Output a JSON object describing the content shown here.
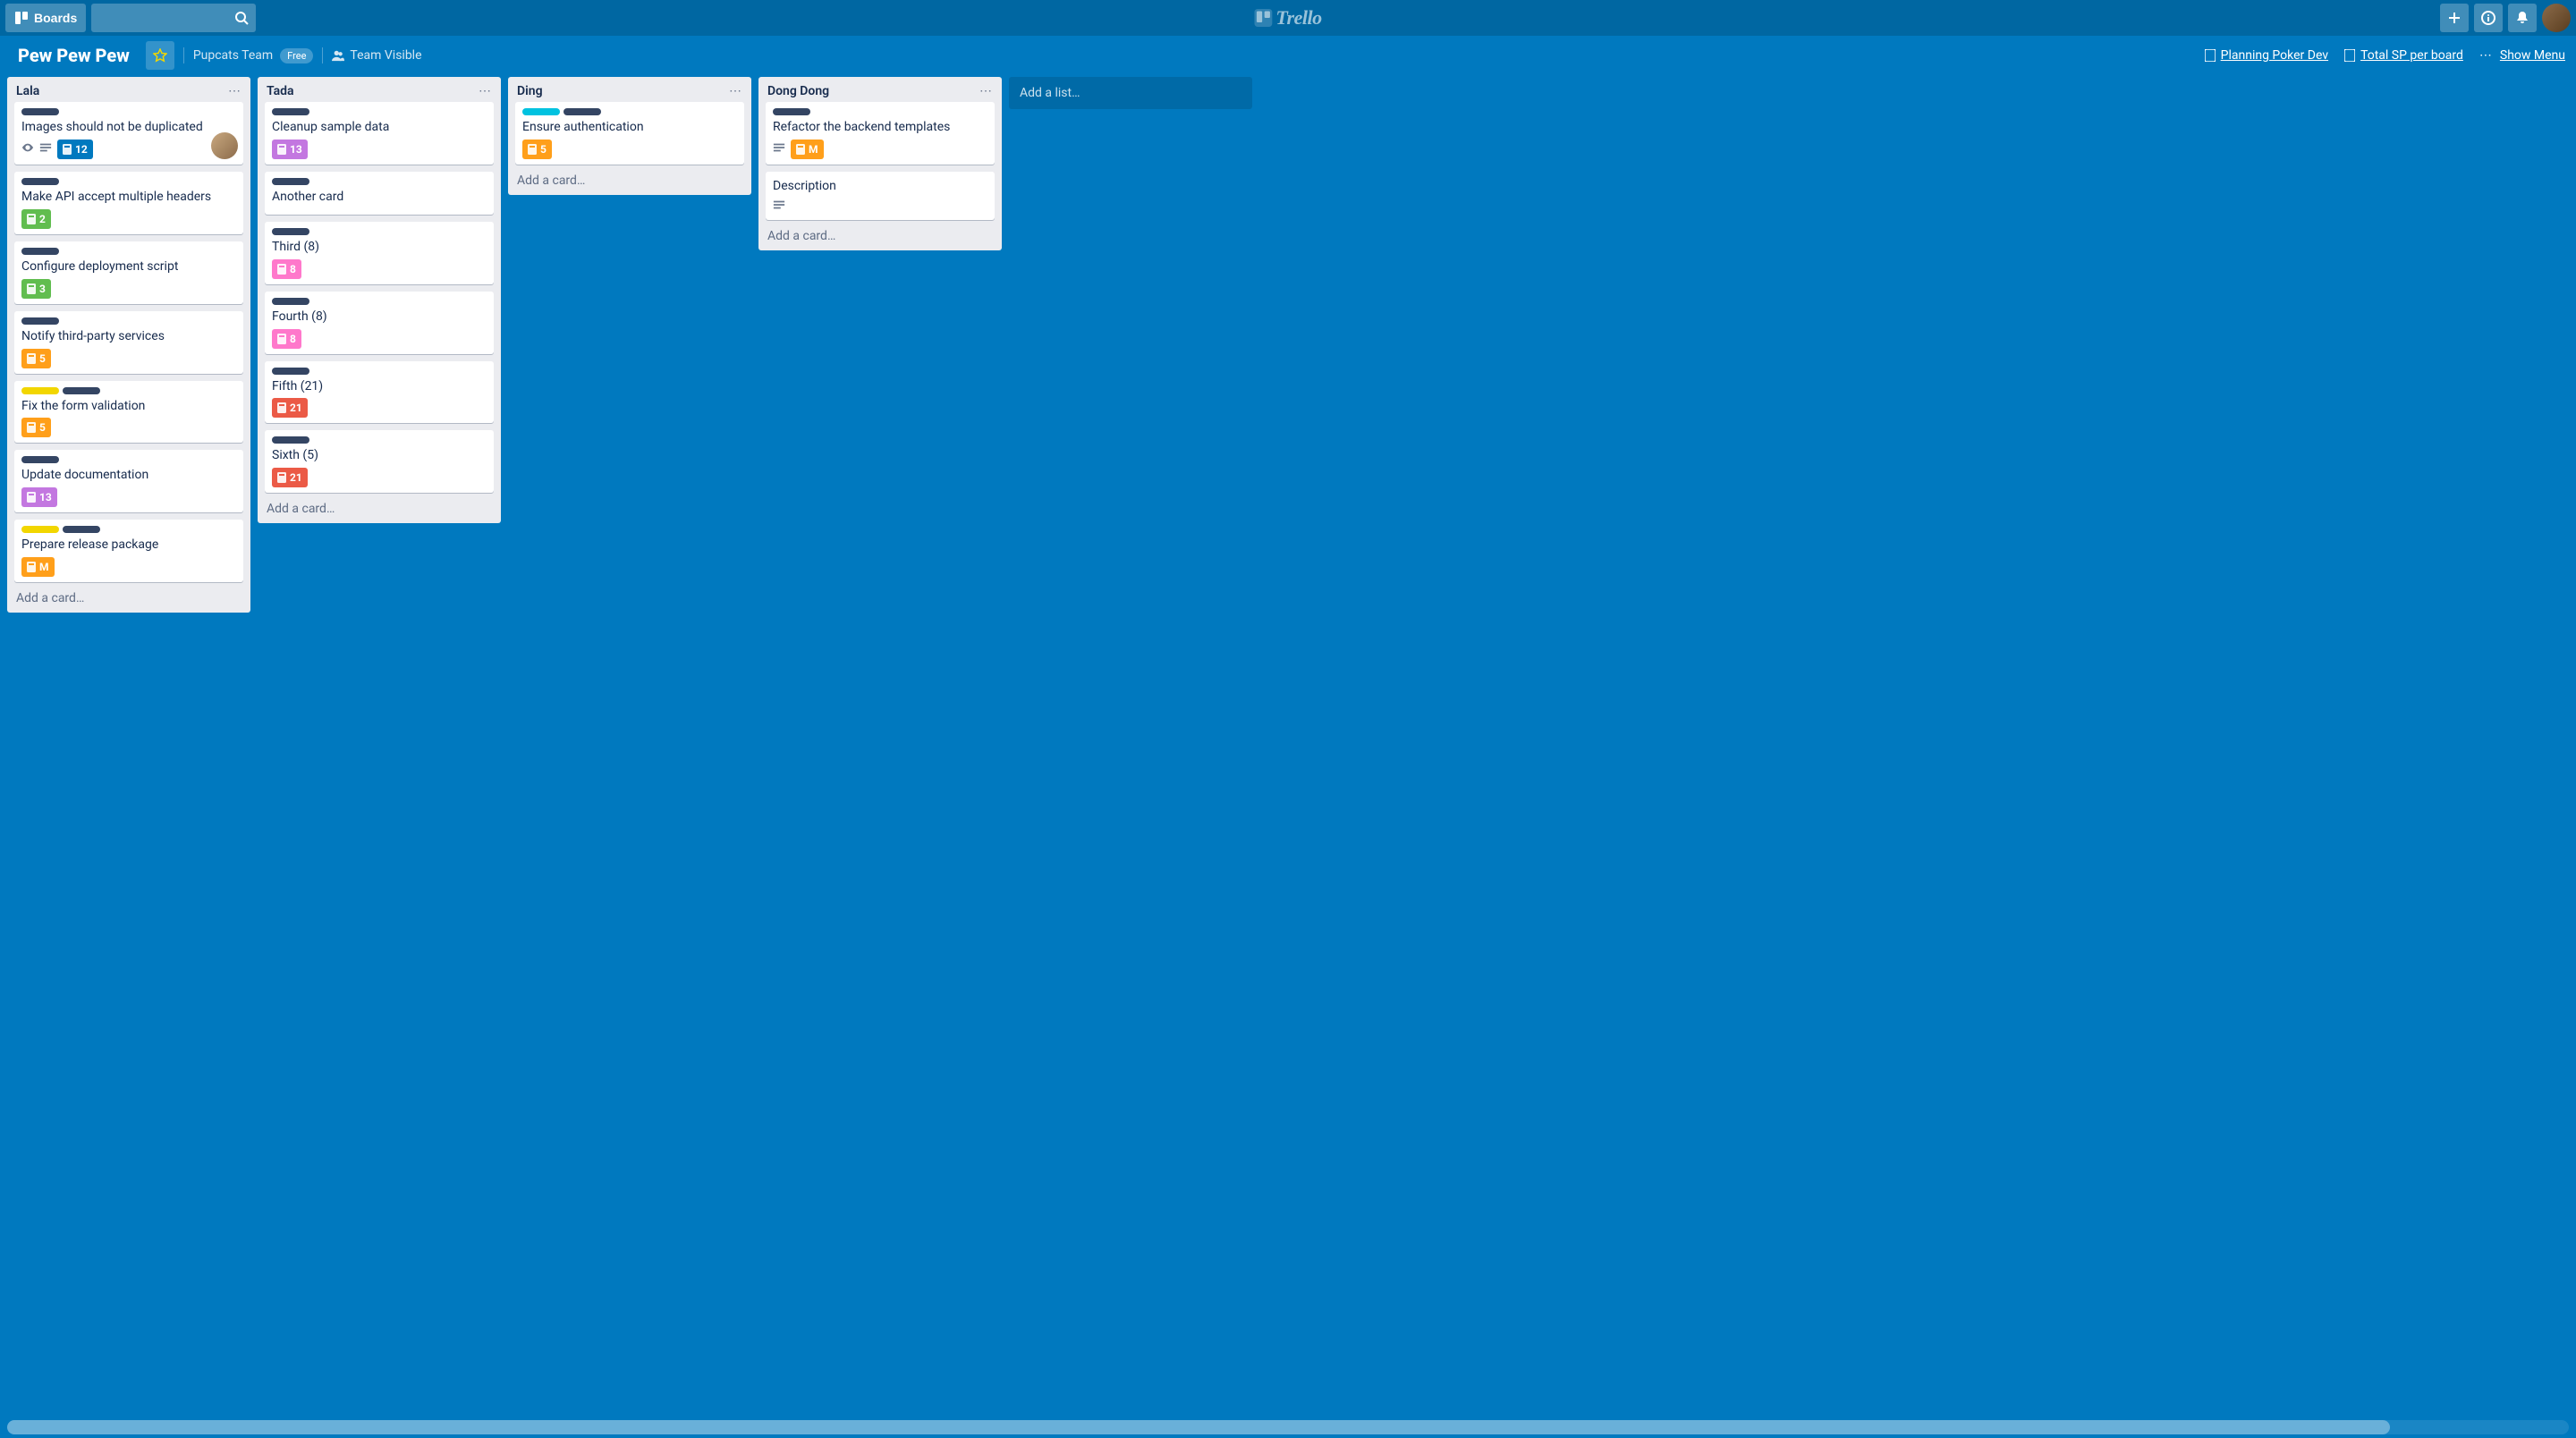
{
  "header": {
    "boards_label": "Boards",
    "brand": "Trello"
  },
  "board": {
    "name": "Pew Pew Pew",
    "team": "Pupcats Team",
    "team_plan": "Free",
    "visibility": "Team Visible",
    "powerups": [
      {
        "label": "Planning Poker Dev"
      },
      {
        "label": "Total SP per board"
      }
    ],
    "show_menu": "Show Menu",
    "add_list": "Add a list…"
  },
  "lists": [
    {
      "title": "Lala",
      "cards": [
        {
          "labels": [
            "black"
          ],
          "title": "Images should not be duplicated",
          "watch": true,
          "desc": true,
          "badge": {
            "bg": "#0079bf",
            "text": "12"
          },
          "member": true
        },
        {
          "labels": [
            "black"
          ],
          "title": "Make API accept multiple headers",
          "badge": {
            "bg": "#61bd4f",
            "text": "2"
          }
        },
        {
          "labels": [
            "black"
          ],
          "title": "Configure deployment script",
          "badge": {
            "bg": "#61bd4f",
            "text": "3"
          }
        },
        {
          "labels": [
            "black"
          ],
          "title": "Notify third-party services",
          "badge": {
            "bg": "#ff9f1a",
            "text": "5"
          }
        },
        {
          "labels": [
            "yellow",
            "black"
          ],
          "title": "Fix the form validation",
          "badge": {
            "bg": "#ff9f1a",
            "text": "5"
          }
        },
        {
          "labels": [
            "black"
          ],
          "title": "Update documentation",
          "badge": {
            "bg": "#c377e0",
            "text": "13"
          }
        },
        {
          "labels": [
            "yellow",
            "black"
          ],
          "title": "Prepare release package",
          "badge": {
            "bg": "#ff9f1a",
            "text": "M"
          }
        }
      ],
      "add_card": "Add a card…"
    },
    {
      "title": "Tada",
      "cards": [
        {
          "labels": [
            "black"
          ],
          "title": "Cleanup sample data",
          "badge": {
            "bg": "#c377e0",
            "text": "13"
          }
        },
        {
          "labels": [
            "black"
          ],
          "title": "Another card"
        },
        {
          "labels": [
            "black"
          ],
          "title": "Third (8)",
          "badge": {
            "bg": "#ff78cb",
            "text": "8"
          }
        },
        {
          "labels": [
            "black"
          ],
          "title": "Fourth (8)",
          "badge": {
            "bg": "#ff78cb",
            "text": "8"
          }
        },
        {
          "labels": [
            "black"
          ],
          "title": "Fifth (21)",
          "badge": {
            "bg": "#eb5a46",
            "text": "21"
          }
        },
        {
          "labels": [
            "black"
          ],
          "title": "Sixth (5)",
          "badge": {
            "bg": "#eb5a46",
            "text": "21"
          }
        }
      ],
      "add_card": "Add a card…"
    },
    {
      "title": "Ding",
      "cards": [
        {
          "labels": [
            "sky",
            "black"
          ],
          "title": "Ensure authentication",
          "badge": {
            "bg": "#ff9f1a",
            "text": "5"
          }
        }
      ],
      "add_card": "Add a card…"
    },
    {
      "title": "Dong Dong",
      "cards": [
        {
          "labels": [
            "black"
          ],
          "title": "Refactor the backend templates",
          "desc": true,
          "badge": {
            "bg": "#ff9f1a",
            "text": "M"
          }
        },
        {
          "title": "Description",
          "desc": true
        }
      ],
      "add_card": "Add a card…"
    }
  ]
}
